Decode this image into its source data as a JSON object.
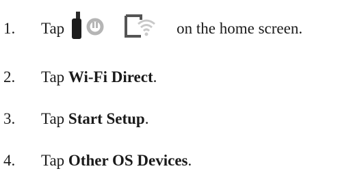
{
  "steps": [
    {
      "number": "1.",
      "prefix": "Tap",
      "suffix": "on the home screen.",
      "icons": [
        "wifi-signal-icon",
        "wifi-direct-icon"
      ]
    },
    {
      "number": "2.",
      "prefix": "Tap ",
      "bold": "Wi-Fi Direct",
      "suffix": "."
    },
    {
      "number": "3.",
      "prefix": "Tap ",
      "bold": "Start Setup",
      "suffix": "."
    },
    {
      "number": "4.",
      "prefix": "Tap ",
      "bold": "Other OS Devices",
      "suffix": "."
    }
  ]
}
